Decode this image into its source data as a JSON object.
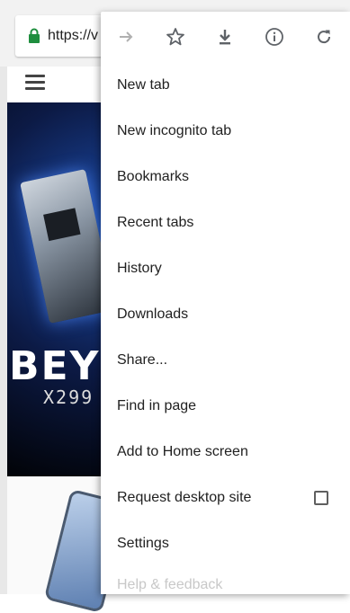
{
  "browser": {
    "url_prefix": "https://v",
    "secure": true
  },
  "page": {
    "banner_title": "BEYO",
    "banner_subtitle": "X299 S"
  },
  "menu": {
    "icon_row": [
      "forward-icon",
      "bookmark-star-icon",
      "download-icon",
      "info-icon",
      "reload-icon"
    ],
    "items": [
      {
        "label": "New tab"
      },
      {
        "label": "New incognito tab"
      },
      {
        "label": "Bookmarks"
      },
      {
        "label": "Recent tabs"
      },
      {
        "label": "History"
      },
      {
        "label": "Downloads"
      },
      {
        "label": "Share..."
      },
      {
        "label": "Find in page"
      },
      {
        "label": "Add to Home screen"
      },
      {
        "label": "Request desktop site",
        "checked": false
      },
      {
        "label": "Settings"
      },
      {
        "label": "Help & feedback"
      }
    ]
  },
  "colors": {
    "lock": "#1e8e3e",
    "icon": "#5f6368",
    "icon_disabled": "#b0b0b0"
  }
}
